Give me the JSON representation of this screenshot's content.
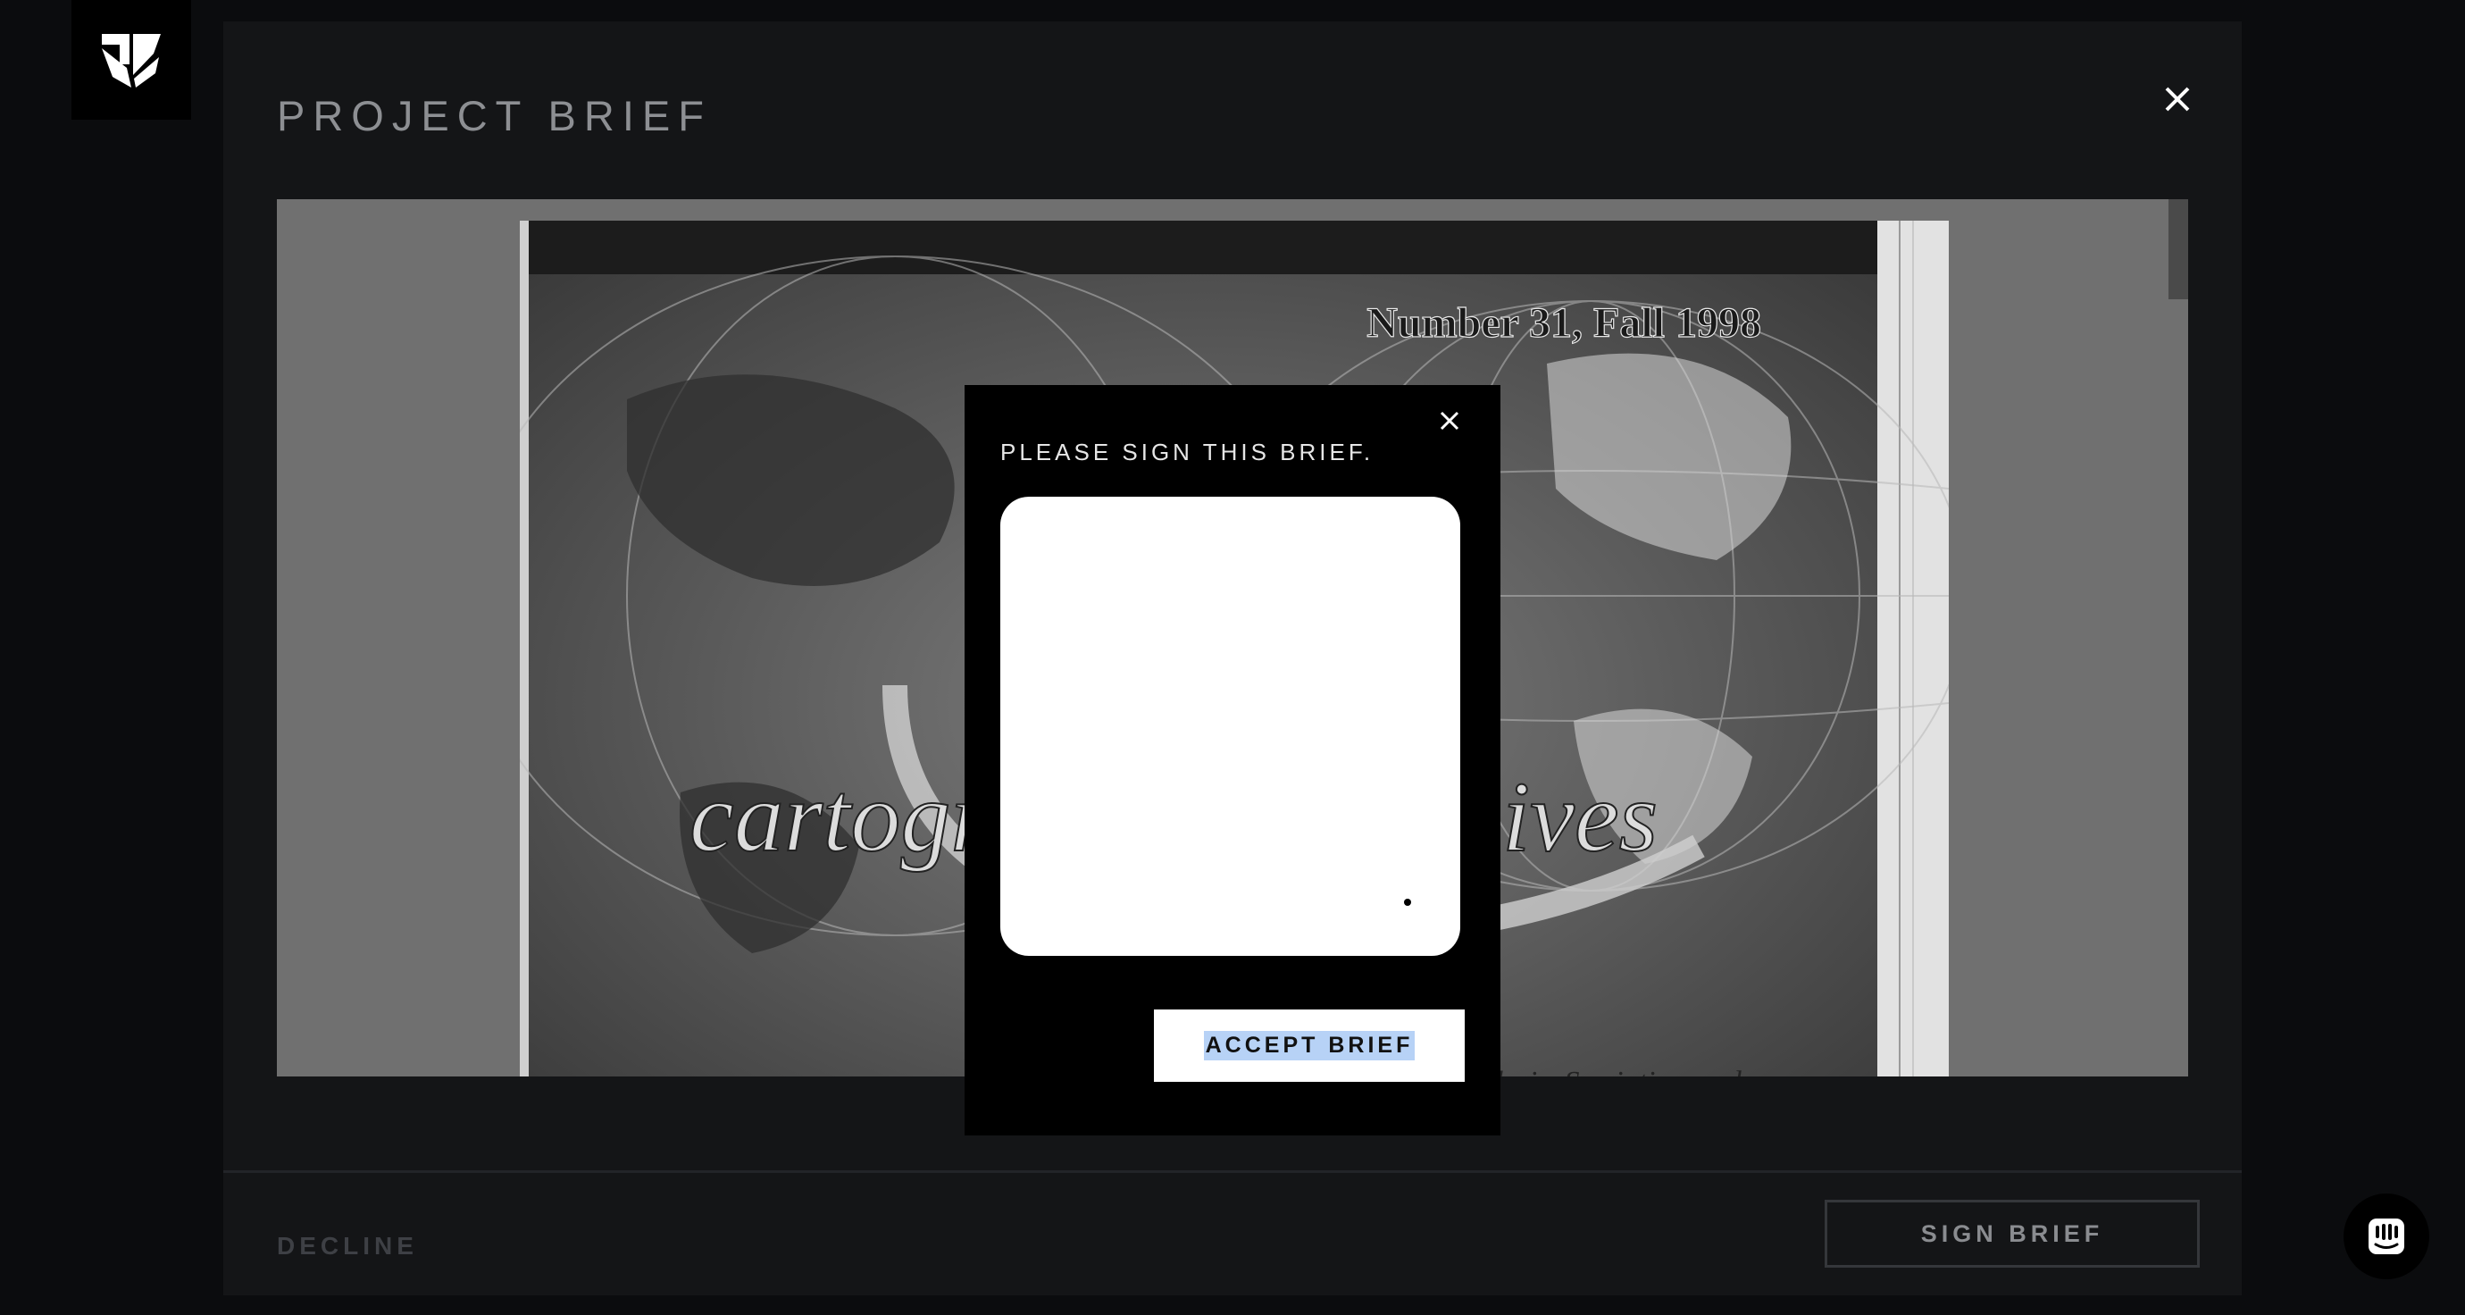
{
  "app": {
    "logo": "brand-logo-icon"
  },
  "panel": {
    "title": "PROJECT BRIEF",
    "close_icon": "close-icon",
    "footer": {
      "decline_label": "DECLINE",
      "sign_label": "SIGN BRIEF"
    }
  },
  "document": {
    "cover_issue": "Number 31, Fall 1998",
    "cover_title_left": "cartogr",
    "cover_title_right": "ives",
    "cover_subtitle_fragment": "alysis, Semiotics, and"
  },
  "modal": {
    "title": "PLEASE SIGN THIS BRIEF.",
    "close_icon": "close-icon",
    "accept_label": "ACCEPT BRIEF"
  },
  "chat": {
    "icon": "chat-icon"
  },
  "colors": {
    "page_bg": "#0b0c0e",
    "panel_bg": "#141517",
    "modal_bg": "#000000",
    "selection_highlight": "#b7d2f6"
  }
}
